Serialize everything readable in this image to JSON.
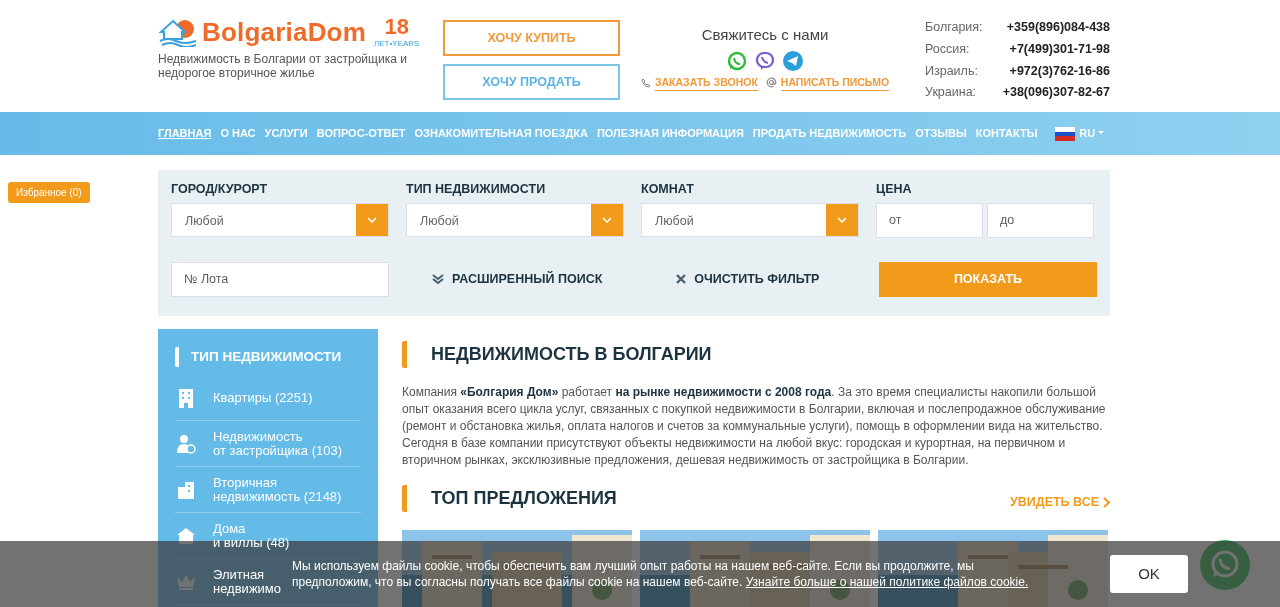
{
  "logo": {
    "brand": "BolgariaDom",
    "years": "18",
    "years_caption": "ЛЕТ•YEARS",
    "tagline": "Недвижимость в Болгарии от застройщика и недорогое вторичное жилье"
  },
  "header_buttons": [
    {
      "label": "ХОЧУ КУПИТЬ",
      "kind": "buy"
    },
    {
      "label": "ХОЧУ ПРОДАТЬ",
      "kind": "sell"
    }
  ],
  "contact": {
    "title": "Свяжитесь с нами",
    "links": [
      {
        "label": "ЗАКАЗАТЬ ЗВОНОК",
        "kind": "phone"
      },
      {
        "label": "НАПИСАТЬ ПИСЬМО",
        "kind": "email"
      }
    ]
  },
  "phones": [
    {
      "country": "Болгария:",
      "number": "+359(896)084-438"
    },
    {
      "country": "Россия:",
      "number": "+7(499)301-71-98"
    },
    {
      "country": "Израиль:",
      "number": "+972(3)762-16-86"
    },
    {
      "country": "Украина:",
      "number": "+38(096)307-82-67"
    }
  ],
  "nav": {
    "items": [
      {
        "label": "ГЛАВНАЯ",
        "selected": true
      },
      {
        "label": "О НАС",
        "selected": false
      },
      {
        "label": "УСЛУГИ",
        "selected": false
      },
      {
        "label": "ВОПРОС-ОТВЕТ",
        "selected": false
      },
      {
        "label": "ОЗНАКОМИТЕЛЬНАЯ ПОЕЗДКА",
        "selected": false
      },
      {
        "label": "ПОЛЕЗНАЯ ИНФОРМАЦИЯ",
        "selected": false
      },
      {
        "label": "ПРОДАТЬ НЕДВИЖИМОСТЬ",
        "selected": false
      },
      {
        "label": "ОТЗЫВЫ",
        "selected": false
      },
      {
        "label": "КОНТАКТЫ",
        "selected": false
      }
    ],
    "language": "RU"
  },
  "favorites": "Избранное (0)",
  "search": {
    "fields": [
      {
        "label": "ГОРОД/КУРОРТ",
        "kind": "select",
        "value": "Любой"
      },
      {
        "label": "ТИП НЕДВИЖИМОСТИ",
        "kind": "select",
        "value": "Любой"
      },
      {
        "label": "КОМНАТ",
        "kind": "select",
        "value": "Любой"
      },
      {
        "label": "ЦЕНА",
        "kind": "range",
        "placeholders": [
          "от",
          "до"
        ]
      }
    ],
    "lot_placeholder": "№ Лота",
    "advanced": "РАСШИРЕННЫЙ ПОИСК",
    "clear": "ОЧИСТИТЬ ФИЛЬТР",
    "submit": "ПОКАЗАТЬ"
  },
  "sidebar": {
    "title": "ТИП НЕДВИЖИМОСТИ",
    "items": [
      {
        "lines": [
          "Квартиры (2251)"
        ]
      },
      {
        "lines": [
          "Недвижимость",
          "от застройщика (103)"
        ]
      },
      {
        "lines": [
          "Вторичная",
          "недвижимость (2148)"
        ]
      },
      {
        "lines": [
          "Дома",
          "и виллы (48)"
        ]
      },
      {
        "lines": [
          "Элитная",
          "недвижимо"
        ]
      }
    ]
  },
  "intro": {
    "heading": "НЕДВИЖИМОСТЬ В БОЛГАРИИ",
    "text": "Компания **«Болгария Дом»** работает **на рынке недвижимости с 2008 года**. За это время специалисты накопили большой опыт оказания всего цикла услуг, связанных с покупкой недвижимости в Болгарии, включая и послепродажное обслуживание (ремонт и обстановка жилья, оплата налогов и счетов за коммунальные услуги), помощь в оформлении вида на жительство. Сегодня в базе компании присутствуют объекты недвижимости на любой вкус: городская и курортная, на первичном и вторичном рынках, эксклюзивные предложения, дешевая недвижимость от застройщика в Болгарии."
  },
  "top": {
    "heading": "ТОП ПРЕДЛОЖЕНИЯ",
    "see_all": "УВИДЕТЬ ВСЕ"
  },
  "cookie": {
    "text": "Мы используем файлы cookie, чтобы обеспечить вам лучший опыт работы на нашем веб-сайте. Если вы продолжите, мы предположим, что вы согласны получать все файлы cookie на нашем веб-сайте.",
    "link": "Узнайте больше о нашей политике файлов cookie.",
    "button": "OK"
  }
}
